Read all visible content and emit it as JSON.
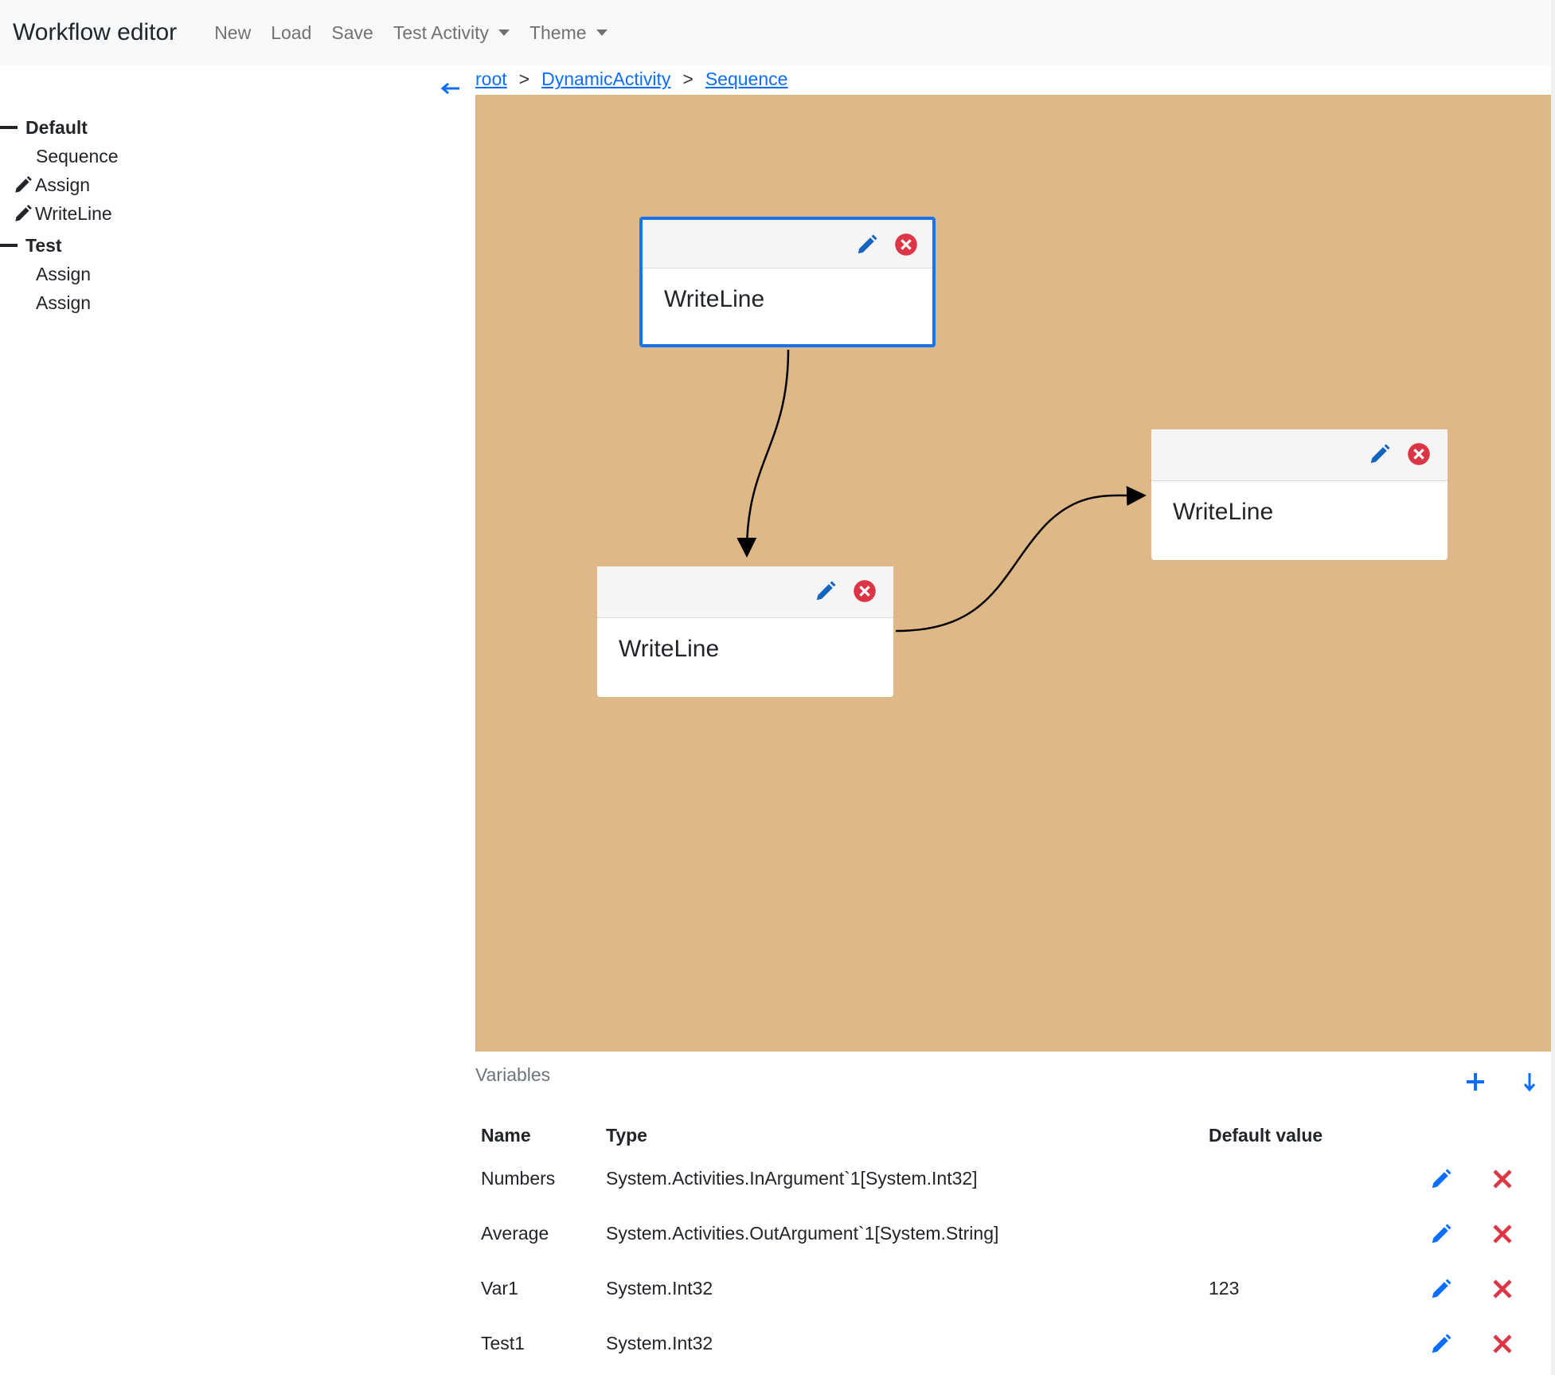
{
  "navbar": {
    "brand": "Workflow editor",
    "items": [
      {
        "label": "New"
      },
      {
        "label": "Load"
      },
      {
        "label": "Save"
      },
      {
        "label": "Test Activity",
        "dropdown": true
      },
      {
        "label": "Theme",
        "dropdown": true
      }
    ]
  },
  "sidebar": {
    "groups": [
      {
        "label": "Default",
        "items": [
          {
            "label": "Sequence",
            "editable": false
          },
          {
            "label": "Assign",
            "editable": true
          },
          {
            "label": "WriteLine",
            "editable": true
          }
        ]
      },
      {
        "label": "Test",
        "items": [
          {
            "label": "Assign",
            "editable": false
          },
          {
            "label": "Assign",
            "editable": false
          }
        ]
      }
    ]
  },
  "breadcrumb": [
    "root",
    "DynamicActivity",
    "Sequence"
  ],
  "breadcrumb_separator": ">",
  "canvas": {
    "background": "#deb887",
    "nodes": [
      {
        "title": "WriteLine",
        "selected": true
      },
      {
        "title": "WriteLine",
        "selected": false
      },
      {
        "title": "WriteLine",
        "selected": false
      }
    ],
    "edges": [
      {
        "from": 0,
        "to": 1
      },
      {
        "from": 1,
        "to": 2
      }
    ]
  },
  "variables": {
    "label": "Variables",
    "columns": [
      "Name",
      "Type",
      "Default value"
    ],
    "rows": [
      {
        "name": "Numbers",
        "type": "System.Activities.InArgument`1[System.Int32]",
        "default": ""
      },
      {
        "name": "Average",
        "type": "System.Activities.OutArgument`1[System.String]",
        "default": ""
      },
      {
        "name": "Var1",
        "type": "System.Int32",
        "default": "123"
      },
      {
        "name": "Test1",
        "type": "System.Int32",
        "default": ""
      }
    ]
  },
  "colors": {
    "accent": "#0d6efd",
    "danger": "#dc3545",
    "node_selected_border": "#1a73e8"
  },
  "icons": {
    "edit": "pencil-icon",
    "delete_node": "circle-x-icon",
    "delete_row": "x-icon",
    "add": "plus-icon",
    "download": "arrow-down-icon",
    "back": "arrow-left-icon"
  }
}
